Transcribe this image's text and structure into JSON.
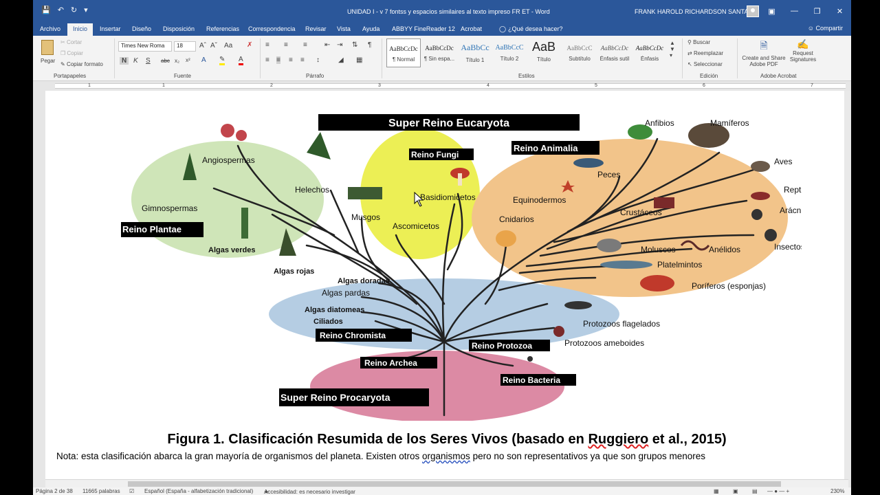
{
  "titlebar": {
    "doc_title": "UNIDAD I - v 7  fontss y espacios  similaires al texto impreso   FR ET  -  Word",
    "user": "FRANK HAROLD RICHARDSON SANTANA"
  },
  "tabs": [
    "Archivo",
    "Inicio",
    "Insertar",
    "Diseño",
    "Disposición",
    "Referencias",
    "Correspondencia",
    "Revisar",
    "Vista",
    "Ayuda",
    "ABBYY FineReader 12",
    "Acrobat",
    "¿Qué desea hacer?"
  ],
  "share_label": "Compartir",
  "ribbon": {
    "clipboard": {
      "paste": "Pegar",
      "cut": "Cortar",
      "copy": "Copiar",
      "format_painter": "Copiar formato",
      "group": "Portapapeles"
    },
    "font": {
      "name": "Times New Roma",
      "size": "18",
      "group": "Fuente"
    },
    "paragraph": {
      "group": "Párrafo"
    },
    "styles": {
      "group": "Estilos",
      "items": [
        {
          "sample": "AaBbCcDc",
          "name": "¶ Normal"
        },
        {
          "sample": "AaBbCcDc",
          "name": "¶ Sin espa..."
        },
        {
          "sample": "AaBbCc",
          "name": "Título 1"
        },
        {
          "sample": "AaBbCcC",
          "name": "Título 2"
        },
        {
          "sample": "AaB",
          "name": "Título"
        },
        {
          "sample": "AaBbCcC",
          "name": "Subtítulo"
        },
        {
          "sample": "AaBbCcDc",
          "name": "Énfasis sutil"
        },
        {
          "sample": "AaBbCcDc",
          "name": "Énfasis"
        }
      ]
    },
    "editing": {
      "find": "Buscar",
      "replace": "Reemplazar",
      "select": "Seleccionar",
      "group": "Edición"
    },
    "acrobat": {
      "create": "Create and Share",
      "create2": "Adobe PDF",
      "request": "Request",
      "request2": "Signatures",
      "group": "Adobe Acrobat"
    }
  },
  "ruler_numbers": [
    "1",
    "1",
    "2",
    "3",
    "4",
    "5",
    "6",
    "7"
  ],
  "figure": {
    "title": "Super Reino Eucaryota",
    "procaryota": "Super Reino Procaryota",
    "kingdoms": {
      "plantae": "Reino Plantae",
      "fungi": "Reino Fungi",
      "animalia": "Reino Animalia",
      "chromista": "Reino Chromista",
      "protozoa": "Reino Protozoa",
      "archea": "Reino Archea",
      "bacteria": "Reino Bacteria"
    },
    "plants": [
      "Angiospermas",
      "Helechos",
      "Gimnospermas",
      "Musgos",
      "Algas verdes",
      "Algas rojas"
    ],
    "fungi": [
      "Basidiomicetos",
      "Ascomicetos"
    ],
    "animals": [
      "Anfibios",
      "Mamíferos",
      "Aves",
      "Peces",
      "Reptiles",
      "Equinodermos",
      "Arácnidos",
      "Crustáceos",
      "Cnidarios",
      "Insectos",
      "Moluscos",
      "Anélidos",
      "Platelmintos",
      "Poríferos (esponjas)"
    ],
    "chromista": [
      "Algas doradas",
      "Algas pardas",
      "Algas diatomeas",
      "Ciliados"
    ],
    "protozoa": [
      "Protozoos flagelados",
      "Protozoos ameboides"
    ]
  },
  "caption": {
    "pre": "Figura 1. Clasificación Resumida de los Seres Vivos (basado en ",
    "author": "Ruggiero",
    "post": " et al., 2015)"
  },
  "note": {
    "pre": "Nota: esta clasificación abarca la gran mayoría de organismos del planeta. Existen otros ",
    "word": "organismos",
    "post": " pero no son representativos ya que son grupos menores"
  },
  "status": {
    "page": "Página 2 de 38",
    "words": "11665 palabras",
    "language": "Español (España - alfabetización tradicional)",
    "accessibility": "Accesibilidad: es necesario investigar",
    "zoom": "230%"
  },
  "colors": {
    "word_blue": "#2b579a",
    "plantae": "#cfe5b8",
    "fungi": "#ecef55",
    "animalia": "#f2c48a",
    "protozoa": "#b5cde3",
    "procaryota": "#dc8aa4"
  }
}
